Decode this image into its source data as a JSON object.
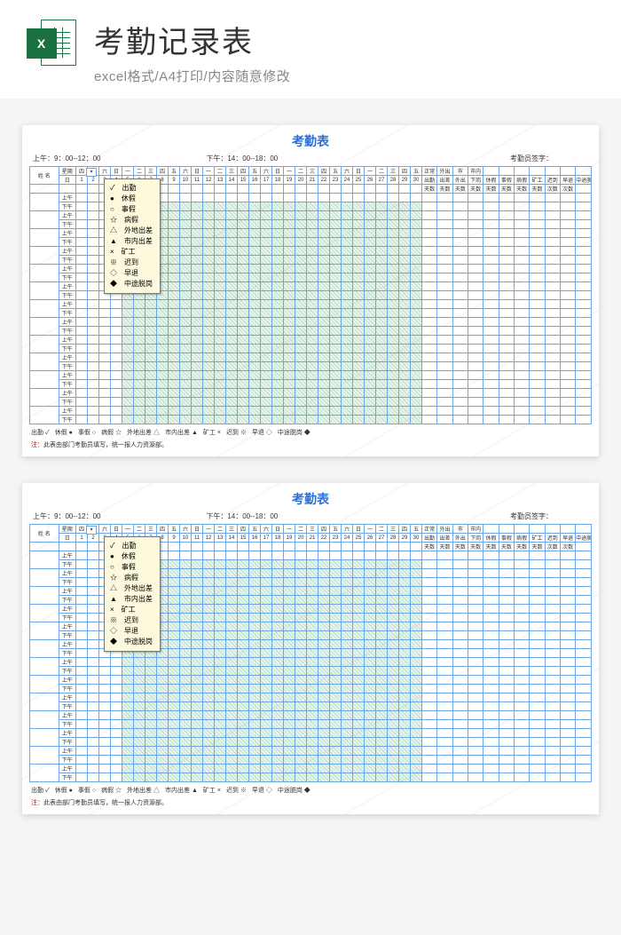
{
  "header": {
    "icon_text": "X",
    "title": "考勤记录表",
    "subtitle": "excel格式/A4打印/内容随意修改"
  },
  "sheet": {
    "title": "考勤表",
    "time_am_label": "上午：9：00--12：00",
    "time_pm_label": "下午：14：00--18：00",
    "signer_label": "考勤员签字：",
    "name_header": "姓 名",
    "week_header": "星期",
    "day_header": "日",
    "shift_am": "上午",
    "shift_pm": "下午",
    "weekdays": [
      "四",
      "五",
      "六",
      "日",
      "一",
      "二",
      "三",
      "四",
      "五",
      "六",
      "日",
      "一",
      "二",
      "三",
      "四",
      "五",
      "六",
      "日",
      "一",
      "二",
      "三",
      "四",
      "五",
      "六",
      "日",
      "一",
      "二",
      "三",
      "四",
      "五"
    ],
    "days": [
      "1",
      "2",
      "3",
      "4",
      "5",
      "6",
      "7",
      "8",
      "9",
      "10",
      "11",
      "12",
      "13",
      "14",
      "15",
      "16",
      "17",
      "18",
      "19",
      "20",
      "21",
      "22",
      "23",
      "24",
      "25",
      "26",
      "27",
      "28",
      "29",
      "30"
    ],
    "summary_line1": [
      "正常",
      "外出",
      "市",
      "市内",
      "",
      "",
      "",
      "",
      "",
      "",
      ""
    ],
    "summary_line2": [
      "出勤",
      "出差",
      "外出",
      "下岗",
      "休假",
      "事假",
      "病假",
      "矿工",
      "迟到",
      "早退",
      "中途脱岗"
    ],
    "summary_line3": [
      "天数",
      "天数",
      "天数",
      "天数",
      "天数",
      "天数",
      "天数",
      "天数",
      "次数",
      "次数",
      ""
    ],
    "legend_items": [
      {
        "sym": "✓",
        "label": "出勤"
      },
      {
        "sym": "●",
        "label": "休假"
      },
      {
        "sym": "○",
        "label": "事假"
      },
      {
        "sym": "☆",
        "label": "病假"
      },
      {
        "sym": "△",
        "label": "外地出差"
      },
      {
        "sym": "▲",
        "label": "市内出差"
      },
      {
        "sym": "×",
        "label": "矿工"
      },
      {
        "sym": "※",
        "label": "迟到"
      },
      {
        "sym": "◇",
        "label": "早退"
      },
      {
        "sym": "◆",
        "label": "中途脱岗"
      }
    ],
    "footnote_label": "注：",
    "footnote_text": "此表由部门考勤员填写，统一报人力资源部。",
    "row_count": 13,
    "dropdown_glyph": "▾"
  }
}
